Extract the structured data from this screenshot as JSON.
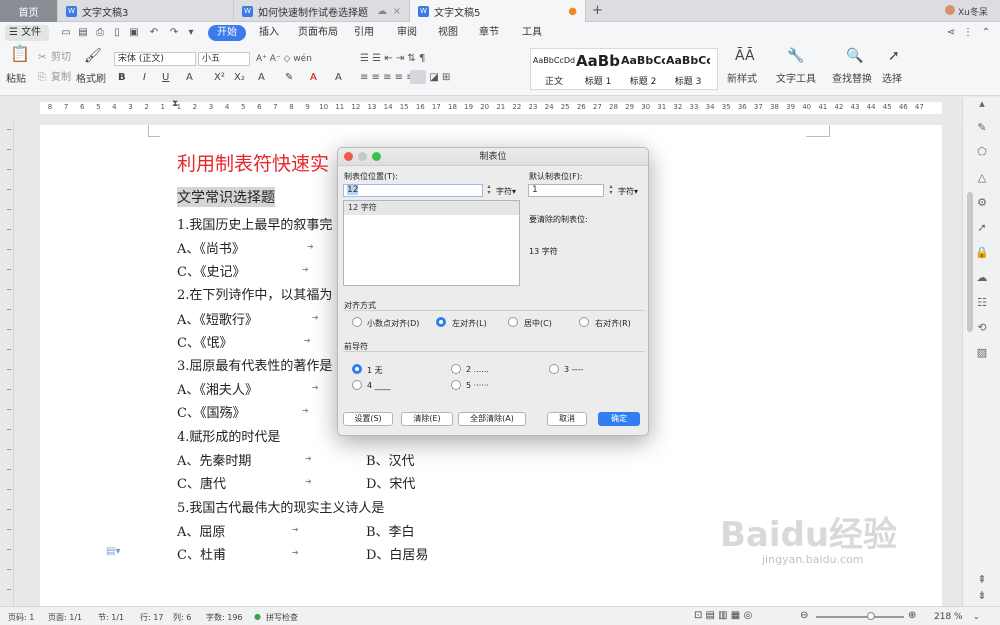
{
  "tabs": {
    "home": "首页",
    "t1": "文字文稿3",
    "t2": "如何快速制作试卷选择题",
    "t3": "文字文稿5",
    "user": "Xu冬呆"
  },
  "menu": {
    "file": "文件",
    "items": [
      "开始",
      "插入",
      "页面布局",
      "引用",
      "审阅",
      "视图",
      "章节",
      "工具"
    ]
  },
  "ribbon": {
    "paste": "粘贴",
    "cut": "剪切",
    "copy": "复制",
    "format_painter": "格式刷",
    "font": "宋体 (正文)",
    "size": "小五",
    "styles": [
      {
        "preview": "AaBbCcDd",
        "name": "正文"
      },
      {
        "preview": "AaBb",
        "name": "标题 1"
      },
      {
        "preview": "AaBbCc",
        "name": "标题 2"
      },
      {
        "preview": "AaBbCc",
        "name": "标题 3"
      }
    ],
    "new_style": "新样式",
    "text_tool": "文字工具",
    "find_replace": "查找替换",
    "select": "选择"
  },
  "ruler_numbers": [
    "8",
    "7",
    "6",
    "5",
    "4",
    "3",
    "2",
    "1",
    "1",
    "2",
    "3",
    "4",
    "5",
    "6",
    "7",
    "8",
    "9",
    "10",
    "11",
    "12",
    "13",
    "14",
    "15",
    "16",
    "17",
    "18",
    "19",
    "20",
    "21",
    "22",
    "23",
    "24",
    "25",
    "26",
    "27",
    "28",
    "29",
    "30",
    "31",
    "32",
    "33",
    "34",
    "35",
    "36",
    "37",
    "38",
    "39",
    "40",
    "41",
    "42",
    "43",
    "44",
    "45",
    "46",
    "47"
  ],
  "document": {
    "title": "利用制表符快速实",
    "heading": "文学常识选择题",
    "lines": [
      "1.我国历史上最早的叙事完",
      "A、《尚书》",
      "C、《史记》",
      "2.在下列诗作中，以其福为",
      "A、《短歌行》",
      "C、《氓》",
      "3.屈原最有代表性的著作是",
      "A、《湘夫人》",
      "C、《国殇》",
      "4.赋形成的时代是",
      "A、先秦时期",
      "B、汉代",
      "C、唐代",
      "D、宋代",
      "5.我国古代最伟大的现实主义诗人是",
      "A、屈原",
      "B、李白",
      "C、杜甫",
      "D、白居易"
    ]
  },
  "dialog": {
    "title": "制表位",
    "tab_pos_label": "制表位位置(T):",
    "tab_pos_value": "12",
    "unit": "字符",
    "list_item": "12 字符",
    "default_label": "默认制表位(F):",
    "default_value": "1",
    "clear_label": "要清除的制表位:",
    "clear_value": "13 字符",
    "align_label": "对齐方式",
    "align_options": [
      "小数点对齐(D)",
      "左对齐(L)",
      "居中(C)",
      "右对齐(R)"
    ],
    "leader_label": "前导符",
    "leader_options": [
      "1 无",
      "2 ......",
      "3 ----",
      "4 ____",
      "5 ······"
    ],
    "buttons": {
      "set": "设置(S)",
      "clear": "清除(E)",
      "clear_all": "全部清除(A)",
      "cancel": "取消",
      "ok": "确定"
    }
  },
  "status": {
    "page_num": "页码: 1",
    "pages": "页面: 1/1",
    "section": "节: 1/1",
    "row": "行: 17",
    "col": "列: 6",
    "words": "字数: 196",
    "spell": "拼写检查",
    "zoom": "218 %"
  },
  "watermark": {
    "main": "Baidu经验",
    "sub": "jingyan.baidu.com"
  }
}
